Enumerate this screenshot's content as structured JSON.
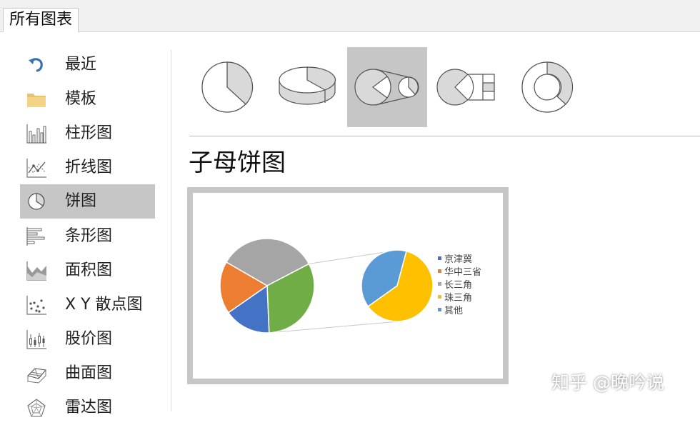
{
  "dialog": {
    "tab_title": "所有图表"
  },
  "sidebar": {
    "items": [
      {
        "label": "最近",
        "icon": "undo-arrow-icon"
      },
      {
        "label": "模板",
        "icon": "folder-icon"
      },
      {
        "label": "柱形图",
        "icon": "column-chart-icon"
      },
      {
        "label": "折线图",
        "icon": "line-chart-icon"
      },
      {
        "label": "饼图",
        "icon": "pie-chart-icon",
        "selected": true
      },
      {
        "label": "条形图",
        "icon": "bar-chart-icon"
      },
      {
        "label": "面积图",
        "icon": "area-chart-icon"
      },
      {
        "label": "X Y 散点图",
        "icon": "scatter-chart-icon"
      },
      {
        "label": "股价图",
        "icon": "stock-chart-icon"
      },
      {
        "label": "曲面图",
        "icon": "surface-chart-icon"
      },
      {
        "label": "雷达图",
        "icon": "radar-chart-icon"
      }
    ]
  },
  "gallery": {
    "items": [
      {
        "icon": "pie-icon"
      },
      {
        "icon": "3d-pie-icon"
      },
      {
        "icon": "pie-of-pie-icon",
        "selected": true
      },
      {
        "icon": "bar-of-pie-icon"
      },
      {
        "icon": "doughnut-icon"
      }
    ]
  },
  "subtype_title": "子母饼图",
  "colors": {
    "selected_bg": "#c6c6c6",
    "blue": "#4472c4",
    "orange": "#ed7d31",
    "gray": "#a5a5a5",
    "gold": "#ffc000",
    "light_blue": "#5b9bd5",
    "green": "#70ad47"
  },
  "chart_data": {
    "type": "pie",
    "subtype": "pie-of-pie",
    "title": "",
    "legend": [
      "京津冀",
      "华中三省",
      "长三角",
      "珠三角",
      "其他"
    ],
    "legend_position": "right",
    "main_pie_slices": [
      {
        "name": "长三角",
        "value": 34
      },
      {
        "name": "",
        "value": 32
      },
      {
        "name": "京津冀",
        "value": 16
      },
      {
        "name": "华中三省",
        "value": 18
      }
    ],
    "secondary_pie_slices": [
      {
        "name": "珠三角",
        "value": 61
      },
      {
        "name": "其他",
        "value": 39
      }
    ]
  },
  "watermark": "知乎 @晚吟说"
}
